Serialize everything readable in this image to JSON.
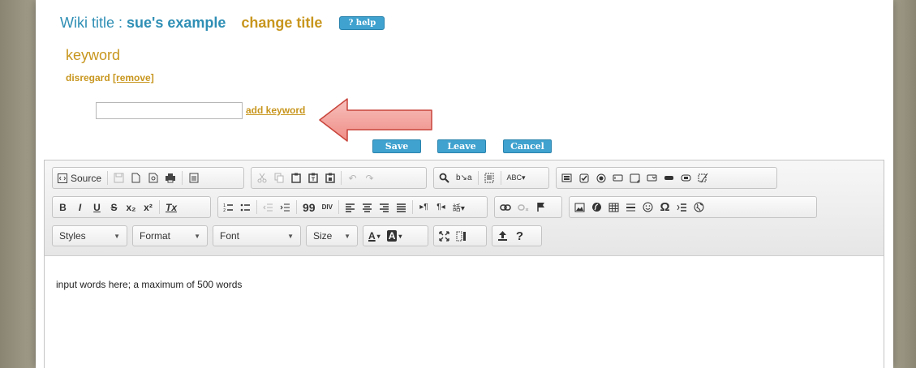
{
  "title_bar": {
    "label": "Wiki title :",
    "name": "sue's example",
    "change": "change title",
    "help": "? help"
  },
  "keyword": {
    "heading": "keyword",
    "disregard": "disregard",
    "remove": "[remove]",
    "input_value": "",
    "add": "add keyword"
  },
  "actions": {
    "save": "Save",
    "leave": "Leave",
    "cancel": "Cancel"
  },
  "toolbar": {
    "source": "Source",
    "row1_icons": [
      "save-icon",
      "new-page-icon",
      "preview-icon",
      "print-icon",
      "templates-icon",
      "cut-icon",
      "copy-icon",
      "paste-icon",
      "paste-text-icon",
      "paste-word-icon",
      "undo-icon",
      "redo-icon",
      "find-icon",
      "replace-icon",
      "select-all-icon",
      "spellcheck-icon",
      "form-icon",
      "checkbox-icon",
      "radio-icon",
      "textfield-icon",
      "textarea-icon",
      "select-icon",
      "button-icon",
      "image-button-icon",
      "hidden-field-icon"
    ],
    "row2": {
      "bold": "B",
      "italic": "I",
      "underline": "U",
      "strike": "S",
      "subscript": "x₂",
      "superscript": "x²",
      "remove_format": "Tx",
      "blockquote": "99",
      "div": "DIV"
    },
    "styles": "Styles",
    "format": "Format",
    "font": "Font",
    "size": "Size",
    "text_color": "A",
    "bg_color": "A",
    "help": "?"
  },
  "editor": {
    "content": "input words here; a maximum of 500 words"
  },
  "colors": {
    "accent_blue": "#3fa2cf",
    "accent_gold": "#c8961e",
    "title_blue": "#2f8fb5"
  }
}
